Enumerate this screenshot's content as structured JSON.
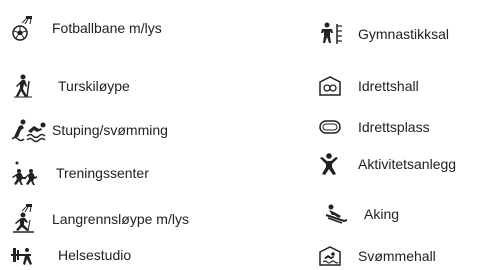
{
  "legend": {
    "left_column": [
      {
        "icon": "football-pitch-with-lights-icon",
        "label": "Fotballbane m/lys"
      },
      {
        "icon": "hiking-trail-icon",
        "label": "Turskiløype"
      },
      {
        "icon": "diving-swimming-icon",
        "label": "Stuping/svømming"
      },
      {
        "icon": "training-center-icon",
        "label": "Treningssenter"
      },
      {
        "icon": "cross-country-ski-trail-lights-icon",
        "label": "Langrennsløype m/lys"
      },
      {
        "icon": "health-studio-icon",
        "label": "Helsestudio"
      }
    ],
    "right_column": [
      {
        "icon": "gymnastics-hall-icon",
        "label": "Gymnastikksal"
      },
      {
        "icon": "sports-hall-icon",
        "label": "Idrettshall"
      },
      {
        "icon": "sports-ground-icon",
        "label": "Idrettsplass"
      },
      {
        "icon": "activity-facility-icon",
        "label": "Aktivitetsanlegg"
      },
      {
        "icon": "sledding-icon",
        "label": "Aking"
      },
      {
        "icon": "swimming-pool-icon",
        "label": "Svømmehall"
      }
    ]
  }
}
